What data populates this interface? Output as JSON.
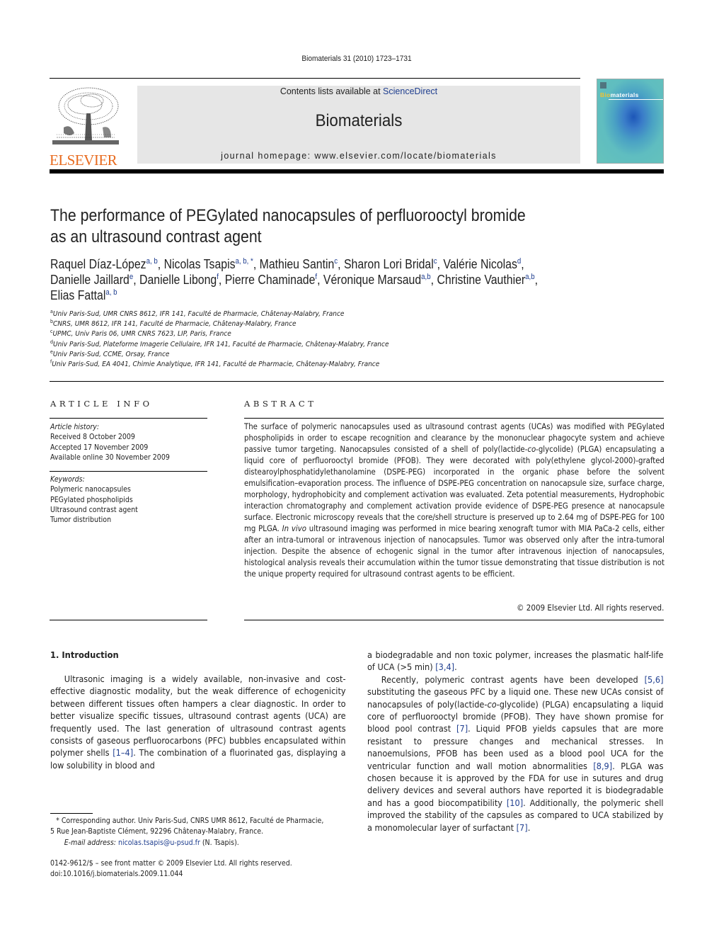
{
  "header": {
    "citation": "Biomaterials 31 (2010) 1723–1731",
    "contents_prefix": "Contents lists available at ",
    "contents_link": "ScienceDirect",
    "journal_name": "Biomaterials",
    "homepage_prefix": "journal homepage: ",
    "homepage_url": "www.elsevier.com/locate/biomaterials",
    "publisher_logo_text": "ELSEVIER",
    "cover_title_accent": "Bio",
    "cover_title_rest": "materials"
  },
  "article": {
    "title_line_1": "The performance of PEGylated nanocapsules of perfluorooctyl bromide",
    "title_line_2": "as an ultrasound contrast agent",
    "authors": [
      {
        "name": "Raquel Díaz-López",
        "affil": "a, b",
        "sep": ", "
      },
      {
        "name": "Nicolas Tsapis",
        "affil": "a, b, *",
        "sep": ", "
      },
      {
        "name": "Mathieu Santin",
        "affil": "c",
        "sep": ", "
      },
      {
        "name": "Sharon Lori Bridal",
        "affil": "c",
        "sep": ", "
      },
      {
        "name": "Valérie Nicolas",
        "affil": "d",
        "sep": ","
      },
      {
        "name": "Danielle Jaillard",
        "affil": "e",
        "sep": ", "
      },
      {
        "name": "Danielle Libong",
        "affil": "f",
        "sep": ", "
      },
      {
        "name": "Pierre Chaminade",
        "affil": "f",
        "sep": ", "
      },
      {
        "name": "Véronique Marsaud",
        "affil": "a,b",
        "sep": ", "
      },
      {
        "name": "Christine Vauthier",
        "affil": "a,b",
        "sep": ","
      },
      {
        "name": "Elias Fattal",
        "affil": "a, b",
        "sep": ""
      }
    ],
    "affiliations": [
      {
        "key": "a",
        "text": "Univ Paris-Sud, UMR CNRS 8612, IFR 141, Faculté de Pharmacie, Châtenay-Malabry, France"
      },
      {
        "key": "b",
        "text": "CNRS, UMR 8612, IFR 141, Faculté de Pharmacie, Châtenay-Malabry, France"
      },
      {
        "key": "c",
        "text": "UPMC, Univ Paris 06, UMR CNRS 7623, LIP, Paris, France"
      },
      {
        "key": "d",
        "text": "Univ Paris-Sud, Plateforme Imagerie Cellulaire, IFR 141, Faculté de Pharmacie, Châtenay-Malabry, France"
      },
      {
        "key": "e",
        "text": "Univ Paris-Sud, CCME, Orsay, France"
      },
      {
        "key": "f",
        "text": "Univ Paris-Sud, EA 4041, Chimie Analytique, IFR 141, Faculté de Pharmacie, Châtenay-Malabry, France"
      }
    ]
  },
  "article_info": {
    "heading": "ARTICLE INFO",
    "history_label": "Article history:",
    "received": "Received 8 October 2009",
    "accepted": "Accepted 17 November 2009",
    "online": "Available online 30 November 2009",
    "keywords_label": "Keywords:",
    "keywords": [
      "Polymeric nanocapsules",
      "PEGylated phospholipids",
      "Ultrasound contrast agent",
      "Tumor distribution"
    ]
  },
  "abstract": {
    "heading": "ABSTRACT",
    "part1": "The surface of polymeric nanocapsules used as ultrasound contrast agents (UCAs) was modified with PEGylated phospholipids in order to escape recognition and clearance by the mononuclear phagocyte system and achieve passive tumor targeting. Nanocapsules consisted of a shell of poly(lactide-",
    "part1_it": "co",
    "part2": "-gly­colide) (PLGA) encapsulating a liquid core of perfluorooctyl bromide (PFOB). They were decorated with poly(ethylene glycol-2000)-grafted distearoylphosphatidylethanolamine (DSPE-PEG) incorporated in the organic phase before the solvent emulsification–evaporation process. The influence of DSPE-PEG concentration on nanocapsule size, surface charge, morphology, hydrophobicity and complement acti­vation was evaluated. Zeta potential measurements, Hydrophobic interaction chromatography and complement activation provide evidence of DSPE-PEG presence at nanocapsule surface. Electronic microscopy reveals that the core/shell structure is preserved up to 2.64 mg of DSPE-PEG for 100 mg PLGA. ",
    "part2_it": "In vivo",
    "part3": " ultrasound imaging was performed in mice bearing xenograft tumor with MIA PaCa-2 cells, either after an intra-tumoral or intravenous injection of nanocapsules. Tumor was observed only after the intra-tumoral injection. Despite the absence of echogenic signal in the tumor after intravenous injection of nanocapsules, histological analysis reveals their accumulation within the tumor tissue demonstrating that tissue distribution is not the unique property required for ultrasound contrast agents to be efficient.",
    "copyright": "© 2009 Elsevier Ltd. All rights reserved."
  },
  "body": {
    "section_heading": "1.  Introduction",
    "left_p1_a": "Ultrasonic imaging is a widely available, non-invasive and cost-effective diagnostic modality, but the weak difference of echoge­nicity between different tissues often hampers a clear diagnostic. In order to better visualize specific tissues, ultrasound contrast agents (UCA) are frequently used. The last generation of ultrasound contrast agents consists of gaseous perfluorocarbons (PFC) bubbles encapsulated within polymer shells ",
    "left_p1_ref": "[1–4]",
    "left_p1_b": ". The combination of a fluorinated gas, displaying a low solubility in blood and",
    "right_p1_a": "a biodegradable and non toxic polymer, increases the plasmatic half-life of UCA (>5 min) ",
    "right_p1_ref": "[3,4]",
    "right_p1_b": ".",
    "right_p2_a": "Recently, polymeric contrast agents have been developed ",
    "right_p2_ref1": "[5,6]",
    "right_p2_b": " substituting the gaseous PFC by a liquid one. These new UCAs consist of nanocapsules of poly(lactide-",
    "right_p2_it": "co",
    "right_p2_c": "-glycolide) (PLGA) encapsulating a liquid core of perfluorooctyl bromide (PFOB). They have shown promise for blood pool contrast ",
    "right_p2_ref2": "[7]",
    "right_p2_d": ". Liquid PFOB yields capsules that are more resistant to pressure changes and mechanical stresses. In nanoemulsions, PFOB has been used as a blood pool UCA for the ventricular function and wall motion abnormalities ",
    "right_p2_ref3": "[8,9]",
    "right_p2_e": ". PLGA was chosen because it is approved by the FDA for use in sutures and drug delivery devices and several authors have reported it is biodegradable and has a good biocom­patibility ",
    "right_p2_ref4": "[10]",
    "right_p2_f": ". Additionally, the polymeric shell improved the stability of the capsules as compared to UCA stabilized by a mono­molecular layer of surfactant ",
    "right_p2_ref5": "[7]",
    "right_p2_g": "."
  },
  "footnote": {
    "corresponding": "* Corresponding author. Univ Paris-Sud, CNRS UMR 8612, Faculté de Pharmacie,",
    "address": "5 Rue Jean-Baptiste Clément, 92296 Châtenay-Malabry, France.",
    "email_label": "E-mail address:",
    "email": "nicolas.tsapis@u-psud.fr",
    "email_suffix": " (N. Tsapis).",
    "front_matter": "0142-9612/$ – see front matter © 2009 Elsevier Ltd. All rights reserved.",
    "doi": "doi:10.1016/j.biomaterials.2009.11.044"
  }
}
